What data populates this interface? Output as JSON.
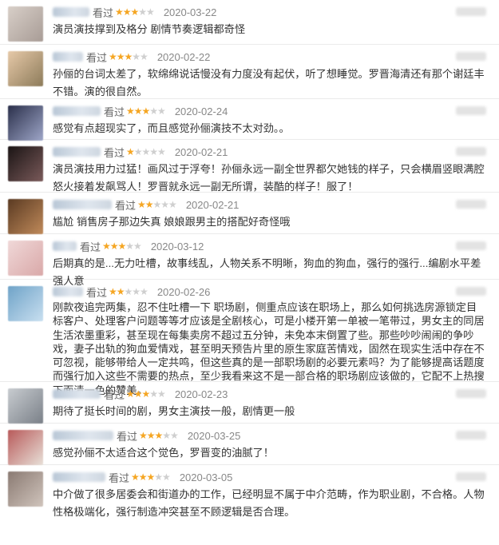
{
  "colors": {
    "star": "#f5a623",
    "star_empty": "#cfcfcf",
    "divider": "#ebebeb"
  },
  "reviews": [
    {
      "status": "看过",
      "rating": 3,
      "date": "2020-03-22",
      "text": "演员演技撑到及格分 剧情节奏逻辑都奇怪",
      "avatar": [
        "#d8cfc8",
        "#a89c96"
      ]
    },
    {
      "status": "看过",
      "rating": 3,
      "date": "2020-02-22",
      "text": "孙俪的台词太差了，软绵绵说话慢没有力度没有起伏，听了想睡觉。罗晋海清还有那个谢廷丰不错。演的很自然。",
      "avatar": [
        "#e6c9a8",
        "#8d7b5a"
      ]
    },
    {
      "status": "看过",
      "rating": 3,
      "date": "2020-02-24",
      "text": "感觉有点超现实了，而且感觉孙俪演技不太对劲。。",
      "avatar": [
        "#2a2f4a",
        "#9ea6c8"
      ]
    },
    {
      "status": "看过",
      "rating": 1,
      "date": "2020-02-21",
      "text": "演员演技用力过猛！画风过于浮夸！孙俪永远一副全世界都欠她钱的样子，只会横眉竖眼满腔怒火接着发飙骂人！罗晋就永远一副无所谓，装酷的样子！服了！",
      "avatar": [
        "#1a1414",
        "#7a5a5a"
      ]
    },
    {
      "status": "看过",
      "rating": 2,
      "date": "2020-02-21",
      "text": "尴尬 销售房子那边失真 娘娘跟男主的搭配好奇怪哦",
      "avatar": [
        "#5a3a22",
        "#c08a5a"
      ]
    },
    {
      "status": "看过",
      "rating": 3,
      "date": "2020-03-12",
      "text": "后期真的是...无力吐槽，故事线乱，人物关系不明晰，狗血的狗血，强行的强行...编剧水平差强人意",
      "avatar": [
        "#f0d8d8",
        "#d9a8a8"
      ]
    },
    {
      "status": "看过",
      "rating": 2,
      "date": "2020-02-26",
      "text": "刚款夜追完两集，忍不住吐槽一下 职场剧，侧重点应该在职场上，那么如何挑选房源锁定目标客户、处理客户问题等等才应该是全剧核心，可是小楼开第一单被一笔带过，男女主的同居生活浓墨重彩，甚至现在每集卖房不超过五分钟，未免本末倒置了些。那些吵吵闹闹的争吵戏，妻子出轨的狗血爱情戏，甚至明天预告片里的原生家庭苦情戏，固然在现实生活中存在不可忽视，能够带给人一定共鸣，但这些真的是一部职场剧的必要元素吗？为了能够提高话题度而强行加入这些不需要的热点，至少我看来这不是一部合格的职场剧应该做的，它配不上热搜下面清一色的赞美。",
      "avatar": [
        "#6fa3c8",
        "#c8dff0"
      ]
    },
    {
      "status": "看过",
      "rating": 3,
      "date": "2020-02-23",
      "text": "期待了挺长时间的剧，男女主演技一般，剧情更一般",
      "avatar": [
        "#c8ccd0",
        "#7a8088"
      ]
    },
    {
      "status": "看过",
      "rating": 3,
      "date": "2020-03-25",
      "text": "感觉孙俪不太适合这个觉色，罗晋变的油腻了！",
      "avatar": [
        "#b85a5a",
        "#e8e0d8"
      ]
    },
    {
      "status": "看过",
      "rating": 3,
      "date": "2020-03-05",
      "text": "中介做了很多居委会和街道办的工作，已经明显不属于中介范畴，作为职业剧，不合格。人物性格极端化，强行制造冲突甚至不顾逻辑是否合理。",
      "avatar": [
        "#8a7a72",
        "#d0c4bc"
      ]
    }
  ]
}
